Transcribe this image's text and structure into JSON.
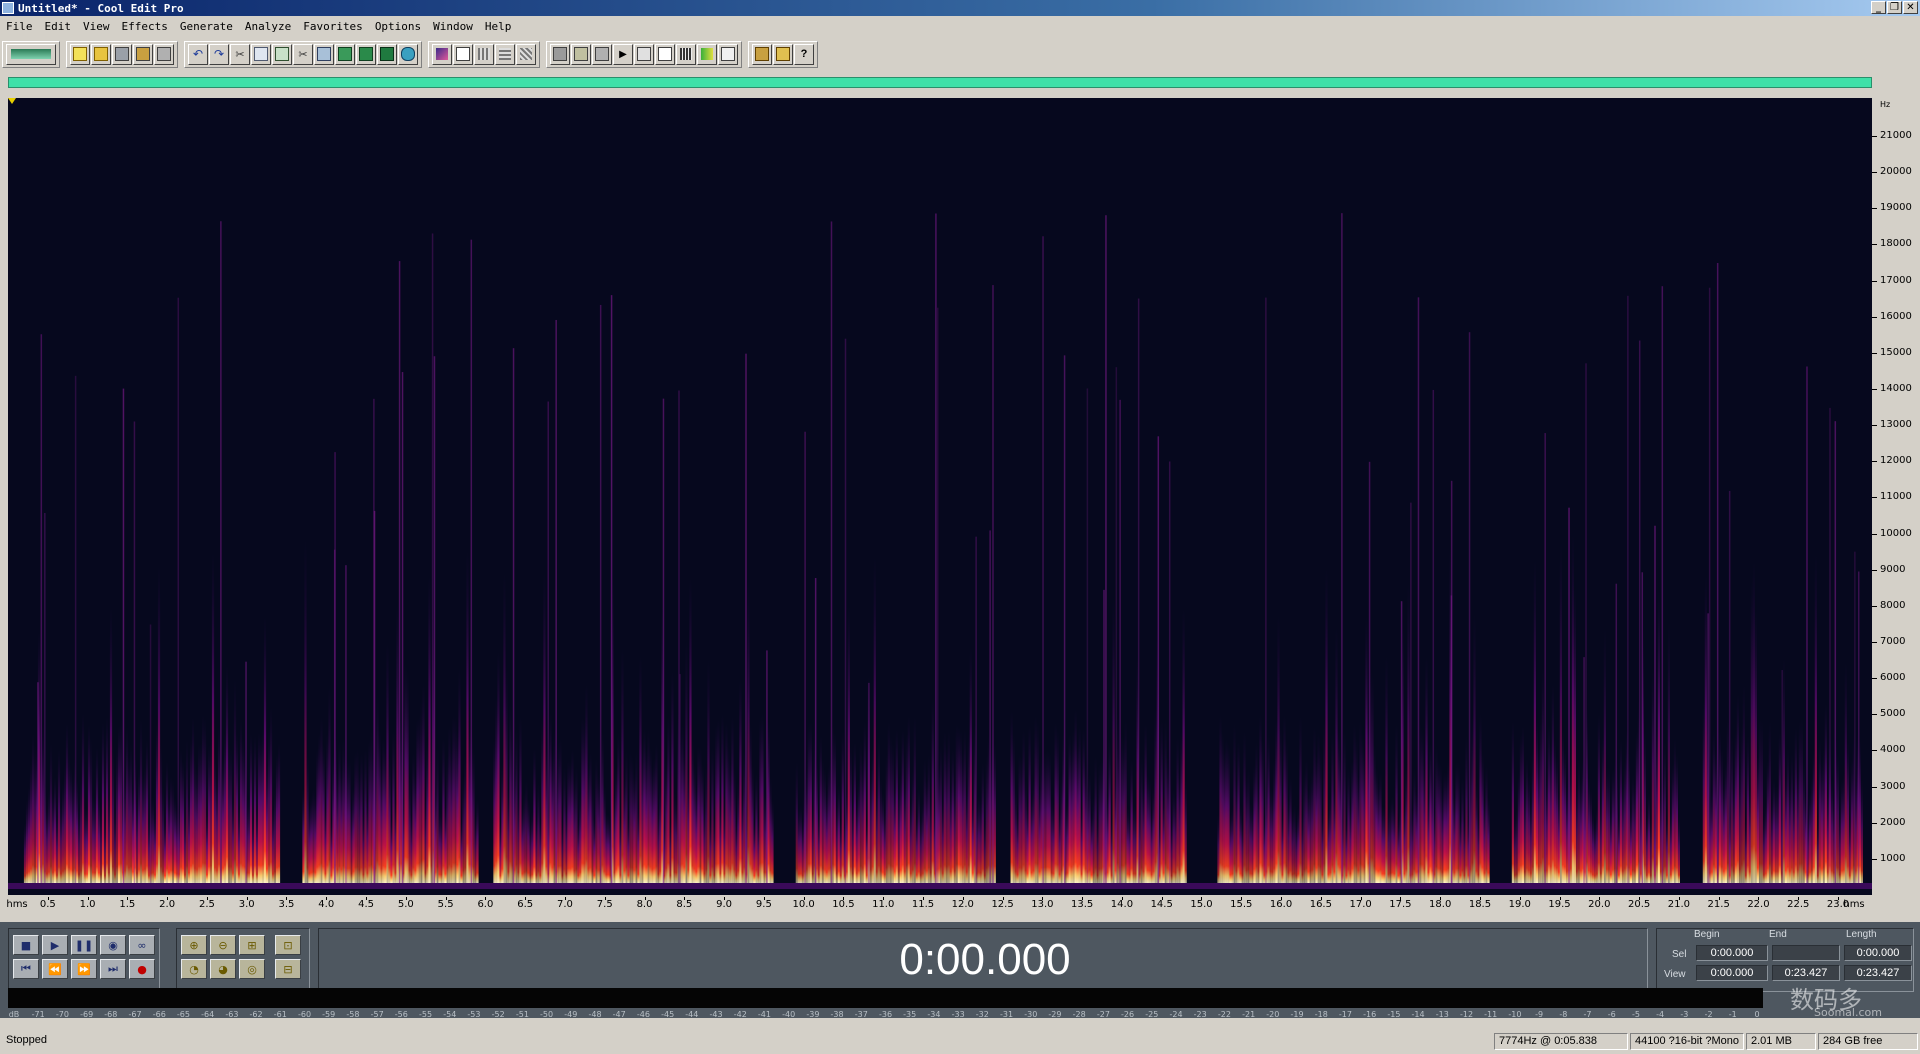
{
  "window": {
    "title": "Untitled* - Cool Edit Pro",
    "minimize": "_",
    "restore": "❐",
    "close": "✕"
  },
  "menu": [
    "File",
    "Edit",
    "View",
    "Effects",
    "Generate",
    "Analyze",
    "Favorites",
    "Options",
    "Window",
    "Help"
  ],
  "yaxis": {
    "unit": "Hz",
    "labels": [
      "21000",
      "20000",
      "19000",
      "18000",
      "17000",
      "16000",
      "15000",
      "14000",
      "13000",
      "12000",
      "11000",
      "10000",
      "9000",
      "8000",
      "7000",
      "6000",
      "5000",
      "4000",
      "3000",
      "2000",
      "1000"
    ]
  },
  "xaxis": {
    "unit_left": "hms",
    "unit_right": "hms",
    "labels": [
      "0.5",
      "1.0",
      "1.5",
      "2.0",
      "2.5",
      "3.0",
      "3.5",
      "4.0",
      "4.5",
      "5.0",
      "5.5",
      "6.0",
      "6.5",
      "7.0",
      "7.5",
      "8.0",
      "8.5",
      "9.0",
      "9.5",
      "10.0",
      "10.5",
      "11.0",
      "11.5",
      "12.0",
      "12.5",
      "13.0",
      "13.5",
      "14.0",
      "14.5",
      "15.0",
      "15.5",
      "16.0",
      "16.5",
      "17.0",
      "17.5",
      "18.0",
      "18.5",
      "19.0",
      "19.5",
      "20.0",
      "20.5",
      "21.0",
      "21.5",
      "22.0",
      "22.5",
      "23.0"
    ]
  },
  "time_display": "0:00.000",
  "selection": {
    "headers": {
      "begin": "Begin",
      "end": "End",
      "length": "Length"
    },
    "sel": {
      "label": "Sel",
      "begin": "0:00.000",
      "end": "",
      "length": "0:00.000"
    },
    "view": {
      "label": "View",
      "begin": "0:00.000",
      "end": "0:23.427",
      "length": "0:23.427"
    }
  },
  "meter_scale": [
    "dB",
    "-71",
    "-70",
    "-69",
    "-68",
    "-67",
    "-66",
    "-65",
    "-64",
    "-63",
    "-62",
    "-61",
    "-60",
    "-59",
    "-58",
    "-57",
    "-56",
    "-55",
    "-54",
    "-53",
    "-52",
    "-51",
    "-50",
    "-49",
    "-48",
    "-47",
    "-46",
    "-45",
    "-44",
    "-43",
    "-42",
    "-41",
    "-40",
    "-39",
    "-38",
    "-37",
    "-36",
    "-35",
    "-34",
    "-33",
    "-32",
    "-31",
    "-30",
    "-29",
    "-28",
    "-27",
    "-26",
    "-25",
    "-24",
    "-23",
    "-22",
    "-21",
    "-20",
    "-19",
    "-18",
    "-17",
    "-16",
    "-15",
    "-14",
    "-13",
    "-12",
    "-11",
    "-10",
    "-9",
    "-8",
    "-7",
    "-6",
    "-5",
    "-4",
    "-3",
    "-2",
    "-1",
    "0"
  ],
  "status": {
    "state": "Stopped",
    "cursor": "7774Hz @   0:05.838",
    "format": "44100 ?16-bit ?Mono",
    "size": "2.01 MB",
    "free": "284 GB free"
  },
  "watermark": {
    "main": "数码多",
    "sub": "Soomal.com"
  },
  "colors": {
    "overview": "#3fe0a8",
    "spectrum_bg": "#06081e",
    "transport_bg": "#4e5760"
  }
}
